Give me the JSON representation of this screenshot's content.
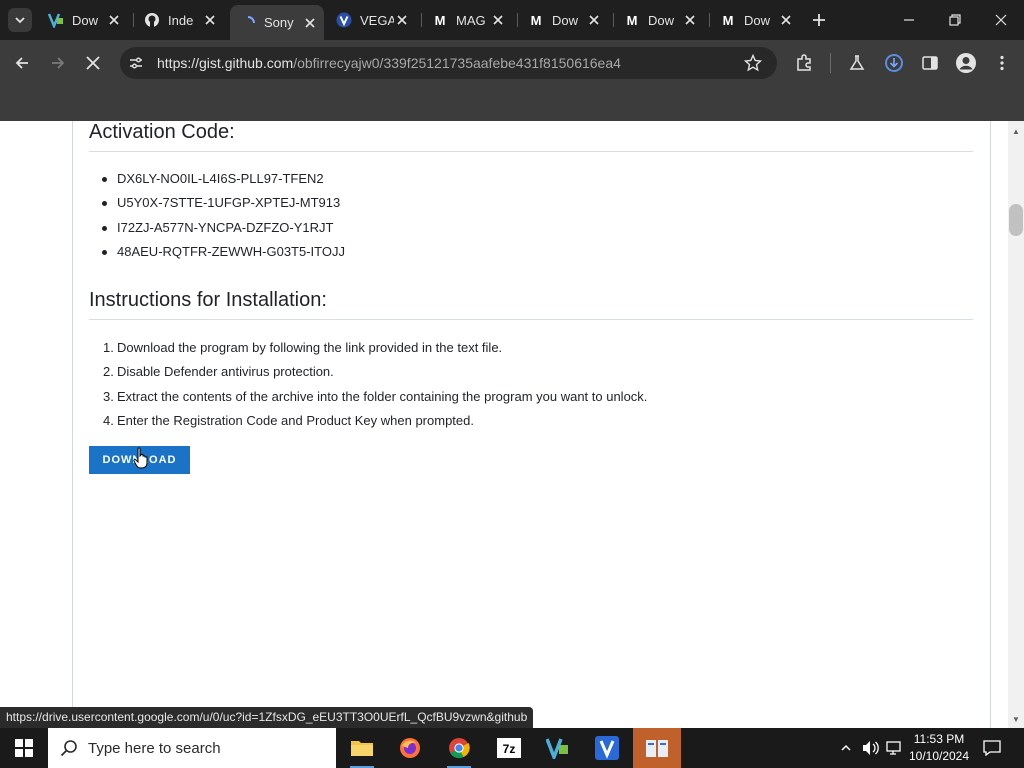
{
  "browser": {
    "tabs": [
      {
        "title": "Dow",
        "icon": "vegas-icon"
      },
      {
        "title": "Inde",
        "icon": "github-icon"
      },
      {
        "title": "Sony",
        "icon": "loading-icon",
        "active": true
      },
      {
        "title": "VEGA",
        "icon": "v-icon"
      },
      {
        "title": "MAG",
        "icon": "m-icon"
      },
      {
        "title": "Dow",
        "icon": "m-icon"
      },
      {
        "title": "Dow",
        "icon": "m-icon"
      },
      {
        "title": "Dow",
        "icon": "m-icon"
      }
    ],
    "url_host": "https://gist.github.com",
    "url_path": "/obfirrecyajw0/339f25121735aafebe431f8150616ea4"
  },
  "page": {
    "activation_heading": "Activation Code:",
    "activation_codes": [
      "DX6LY-NO0IL-L4I6S-PLL97-TFEN2",
      "U5Y0X-7STTE-1UFGP-XPTEJ-MT913",
      "I72ZJ-A577N-YNCPA-DZFZO-Y1RJT",
      "48AEU-RQTFR-ZEWWH-G03T5-ITOJJ"
    ],
    "instructions_heading": "Instructions for Installation:",
    "instructions": [
      {
        "num": "1.",
        "text": "Download the program by following the link provided in the text file."
      },
      {
        "num": "2.",
        "text": "Disable Defender antivirus protection."
      },
      {
        "num": "3.",
        "text": "Extract the contents of the archive into the folder containing the program you want to unlock."
      },
      {
        "num": "4.",
        "text": "Enter the Registration Code and Product Key when prompted."
      }
    ],
    "download_label": "DOWNLOAD"
  },
  "status_link": "https://drive.usercontent.google.com/u/0/uc?id=1ZfsxDG_eEU3TT3O0UErfL_QcfBU9vzwn&github",
  "taskbar": {
    "search_placeholder": "Type here to search",
    "time": "11:53 PM",
    "date": "10/10/2024"
  },
  "colors": {
    "download_button": "#1a73c7",
    "active_app": "#c0602a"
  }
}
